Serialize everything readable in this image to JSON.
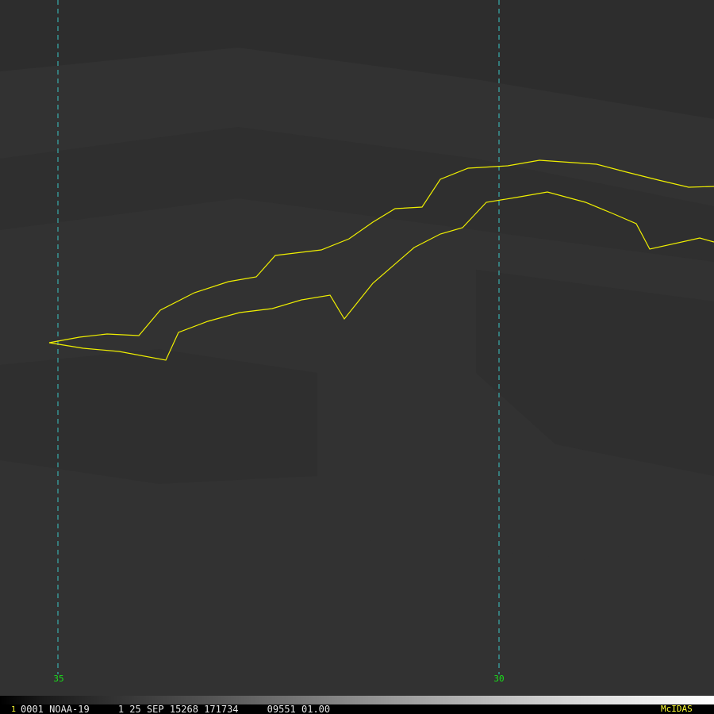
{
  "map": {
    "longitude_labels": [
      "35",
      "30"
    ],
    "coastline_color": "#f0f000",
    "gridline_color": "#39c6c6",
    "label_color": "#19e019"
  },
  "status": {
    "frame_number": "1",
    "text": "0001 NOAA-19     1 25 SEP 15268 171734     09551 01.00",
    "brand": "McIDAS"
  }
}
